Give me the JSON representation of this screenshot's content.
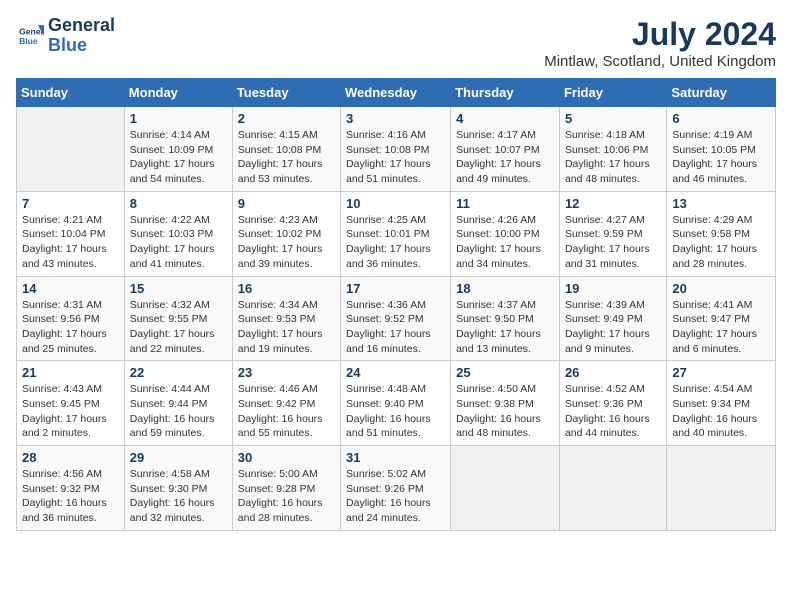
{
  "header": {
    "logo_line1": "General",
    "logo_line2": "Blue",
    "month_year": "July 2024",
    "location": "Mintlaw, Scotland, United Kingdom"
  },
  "days_of_week": [
    "Sunday",
    "Monday",
    "Tuesday",
    "Wednesday",
    "Thursday",
    "Friday",
    "Saturday"
  ],
  "weeks": [
    [
      {
        "day": "",
        "info": ""
      },
      {
        "day": "1",
        "info": "Sunrise: 4:14 AM\nSunset: 10:09 PM\nDaylight: 17 hours\nand 54 minutes."
      },
      {
        "day": "2",
        "info": "Sunrise: 4:15 AM\nSunset: 10:08 PM\nDaylight: 17 hours\nand 53 minutes."
      },
      {
        "day": "3",
        "info": "Sunrise: 4:16 AM\nSunset: 10:08 PM\nDaylight: 17 hours\nand 51 minutes."
      },
      {
        "day": "4",
        "info": "Sunrise: 4:17 AM\nSunset: 10:07 PM\nDaylight: 17 hours\nand 49 minutes."
      },
      {
        "day": "5",
        "info": "Sunrise: 4:18 AM\nSunset: 10:06 PM\nDaylight: 17 hours\nand 48 minutes."
      },
      {
        "day": "6",
        "info": "Sunrise: 4:19 AM\nSunset: 10:05 PM\nDaylight: 17 hours\nand 46 minutes."
      }
    ],
    [
      {
        "day": "7",
        "info": "Sunrise: 4:21 AM\nSunset: 10:04 PM\nDaylight: 17 hours\nand 43 minutes."
      },
      {
        "day": "8",
        "info": "Sunrise: 4:22 AM\nSunset: 10:03 PM\nDaylight: 17 hours\nand 41 minutes."
      },
      {
        "day": "9",
        "info": "Sunrise: 4:23 AM\nSunset: 10:02 PM\nDaylight: 17 hours\nand 39 minutes."
      },
      {
        "day": "10",
        "info": "Sunrise: 4:25 AM\nSunset: 10:01 PM\nDaylight: 17 hours\nand 36 minutes."
      },
      {
        "day": "11",
        "info": "Sunrise: 4:26 AM\nSunset: 10:00 PM\nDaylight: 17 hours\nand 34 minutes."
      },
      {
        "day": "12",
        "info": "Sunrise: 4:27 AM\nSunset: 9:59 PM\nDaylight: 17 hours\nand 31 minutes."
      },
      {
        "day": "13",
        "info": "Sunrise: 4:29 AM\nSunset: 9:58 PM\nDaylight: 17 hours\nand 28 minutes."
      }
    ],
    [
      {
        "day": "14",
        "info": "Sunrise: 4:31 AM\nSunset: 9:56 PM\nDaylight: 17 hours\nand 25 minutes."
      },
      {
        "day": "15",
        "info": "Sunrise: 4:32 AM\nSunset: 9:55 PM\nDaylight: 17 hours\nand 22 minutes."
      },
      {
        "day": "16",
        "info": "Sunrise: 4:34 AM\nSunset: 9:53 PM\nDaylight: 17 hours\nand 19 minutes."
      },
      {
        "day": "17",
        "info": "Sunrise: 4:36 AM\nSunset: 9:52 PM\nDaylight: 17 hours\nand 16 minutes."
      },
      {
        "day": "18",
        "info": "Sunrise: 4:37 AM\nSunset: 9:50 PM\nDaylight: 17 hours\nand 13 minutes."
      },
      {
        "day": "19",
        "info": "Sunrise: 4:39 AM\nSunset: 9:49 PM\nDaylight: 17 hours\nand 9 minutes."
      },
      {
        "day": "20",
        "info": "Sunrise: 4:41 AM\nSunset: 9:47 PM\nDaylight: 17 hours\nand 6 minutes."
      }
    ],
    [
      {
        "day": "21",
        "info": "Sunrise: 4:43 AM\nSunset: 9:45 PM\nDaylight: 17 hours\nand 2 minutes."
      },
      {
        "day": "22",
        "info": "Sunrise: 4:44 AM\nSunset: 9:44 PM\nDaylight: 16 hours\nand 59 minutes."
      },
      {
        "day": "23",
        "info": "Sunrise: 4:46 AM\nSunset: 9:42 PM\nDaylight: 16 hours\nand 55 minutes."
      },
      {
        "day": "24",
        "info": "Sunrise: 4:48 AM\nSunset: 9:40 PM\nDaylight: 16 hours\nand 51 minutes."
      },
      {
        "day": "25",
        "info": "Sunrise: 4:50 AM\nSunset: 9:38 PM\nDaylight: 16 hours\nand 48 minutes."
      },
      {
        "day": "26",
        "info": "Sunrise: 4:52 AM\nSunset: 9:36 PM\nDaylight: 16 hours\nand 44 minutes."
      },
      {
        "day": "27",
        "info": "Sunrise: 4:54 AM\nSunset: 9:34 PM\nDaylight: 16 hours\nand 40 minutes."
      }
    ],
    [
      {
        "day": "28",
        "info": "Sunrise: 4:56 AM\nSunset: 9:32 PM\nDaylight: 16 hours\nand 36 minutes."
      },
      {
        "day": "29",
        "info": "Sunrise: 4:58 AM\nSunset: 9:30 PM\nDaylight: 16 hours\nand 32 minutes."
      },
      {
        "day": "30",
        "info": "Sunrise: 5:00 AM\nSunset: 9:28 PM\nDaylight: 16 hours\nand 28 minutes."
      },
      {
        "day": "31",
        "info": "Sunrise: 5:02 AM\nSunset: 9:26 PM\nDaylight: 16 hours\nand 24 minutes."
      },
      {
        "day": "",
        "info": ""
      },
      {
        "day": "",
        "info": ""
      },
      {
        "day": "",
        "info": ""
      }
    ]
  ]
}
